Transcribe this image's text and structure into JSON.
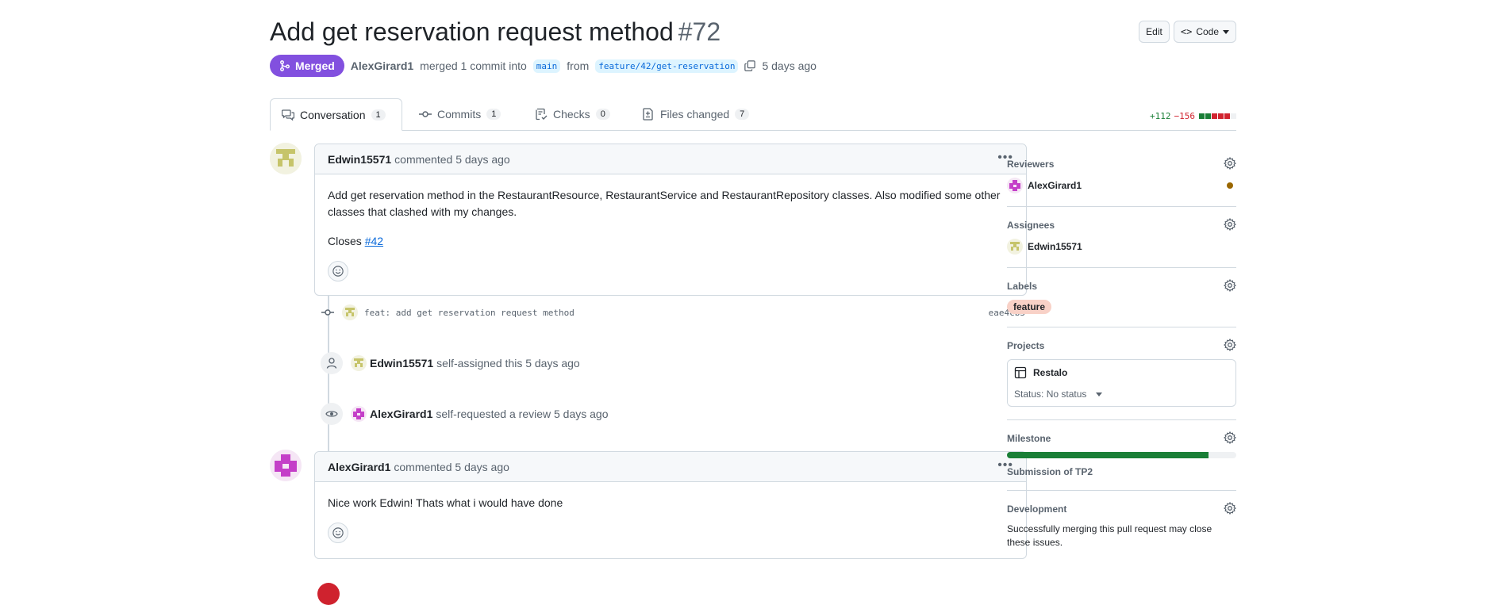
{
  "header": {
    "title": "Add get reservation request method",
    "number": "#72",
    "edit_label": "Edit",
    "code_label": "Code",
    "status_badge": "Merged",
    "author": "AlexGirard1",
    "merge_text": "merged 1 commit into",
    "base_branch": "main",
    "from_text": "from",
    "head_branch": "feature/42/get-reservation",
    "time_ago": "5 days ago"
  },
  "tabs": [
    {
      "label": "Conversation",
      "count": "1",
      "icon": "comment-discussion-icon"
    },
    {
      "label": "Commits",
      "count": "1",
      "icon": "git-commit-icon"
    },
    {
      "label": "Checks",
      "count": "0",
      "icon": "checklist-icon"
    },
    {
      "label": "Files changed",
      "count": "7",
      "icon": "file-diff-icon"
    }
  ],
  "diffstat": {
    "additions": "+112",
    "deletions": "−156",
    "colors": [
      "#1a7f37",
      "#1a7f37",
      "#d1242f",
      "#d1242f",
      "#d1242f",
      "#eff1f3"
    ]
  },
  "timeline": {
    "comment1": {
      "author": "Edwin15571",
      "action": "commented 5 days ago",
      "body": "Add get reservation method in the RestaurantResource, RestaurantService and RestaurantRepository classes. Also modified some other classes that clashed with my changes.",
      "closes_prefix": "Closes",
      "closes_link": "#42"
    },
    "commit": {
      "message": "feat: add get reservation request method",
      "sha": "eae4cb3"
    },
    "event_assign": {
      "author": "Edwin15571",
      "text": "self-assigned this 5 days ago"
    },
    "event_review": {
      "author": "AlexGirard1",
      "text": "self-requested a review 5 days ago"
    },
    "comment2": {
      "author": "AlexGirard1",
      "action": "commented 5 days ago",
      "body": "Nice work Edwin! Thats what i would have done"
    }
  },
  "sidebar": {
    "reviewers": {
      "title": "Reviewers",
      "name": "AlexGirard1"
    },
    "assignees": {
      "title": "Assignees",
      "name": "Edwin15571"
    },
    "labels": {
      "title": "Labels",
      "label": "feature",
      "color": "#f8d1c7"
    },
    "projects": {
      "title": "Projects",
      "name": "Restalo",
      "status": "Status: No status"
    },
    "milestone": {
      "title": "Milestone",
      "name": "Submission of TP2",
      "progress": 0.88
    },
    "development": {
      "title": "Development",
      "text": "Successfully merging this pull request may close these issues."
    }
  },
  "colors": {
    "merged": "#8250df",
    "link": "#0969da",
    "additions": "#1a7f37",
    "deletions": "#d1242f"
  }
}
